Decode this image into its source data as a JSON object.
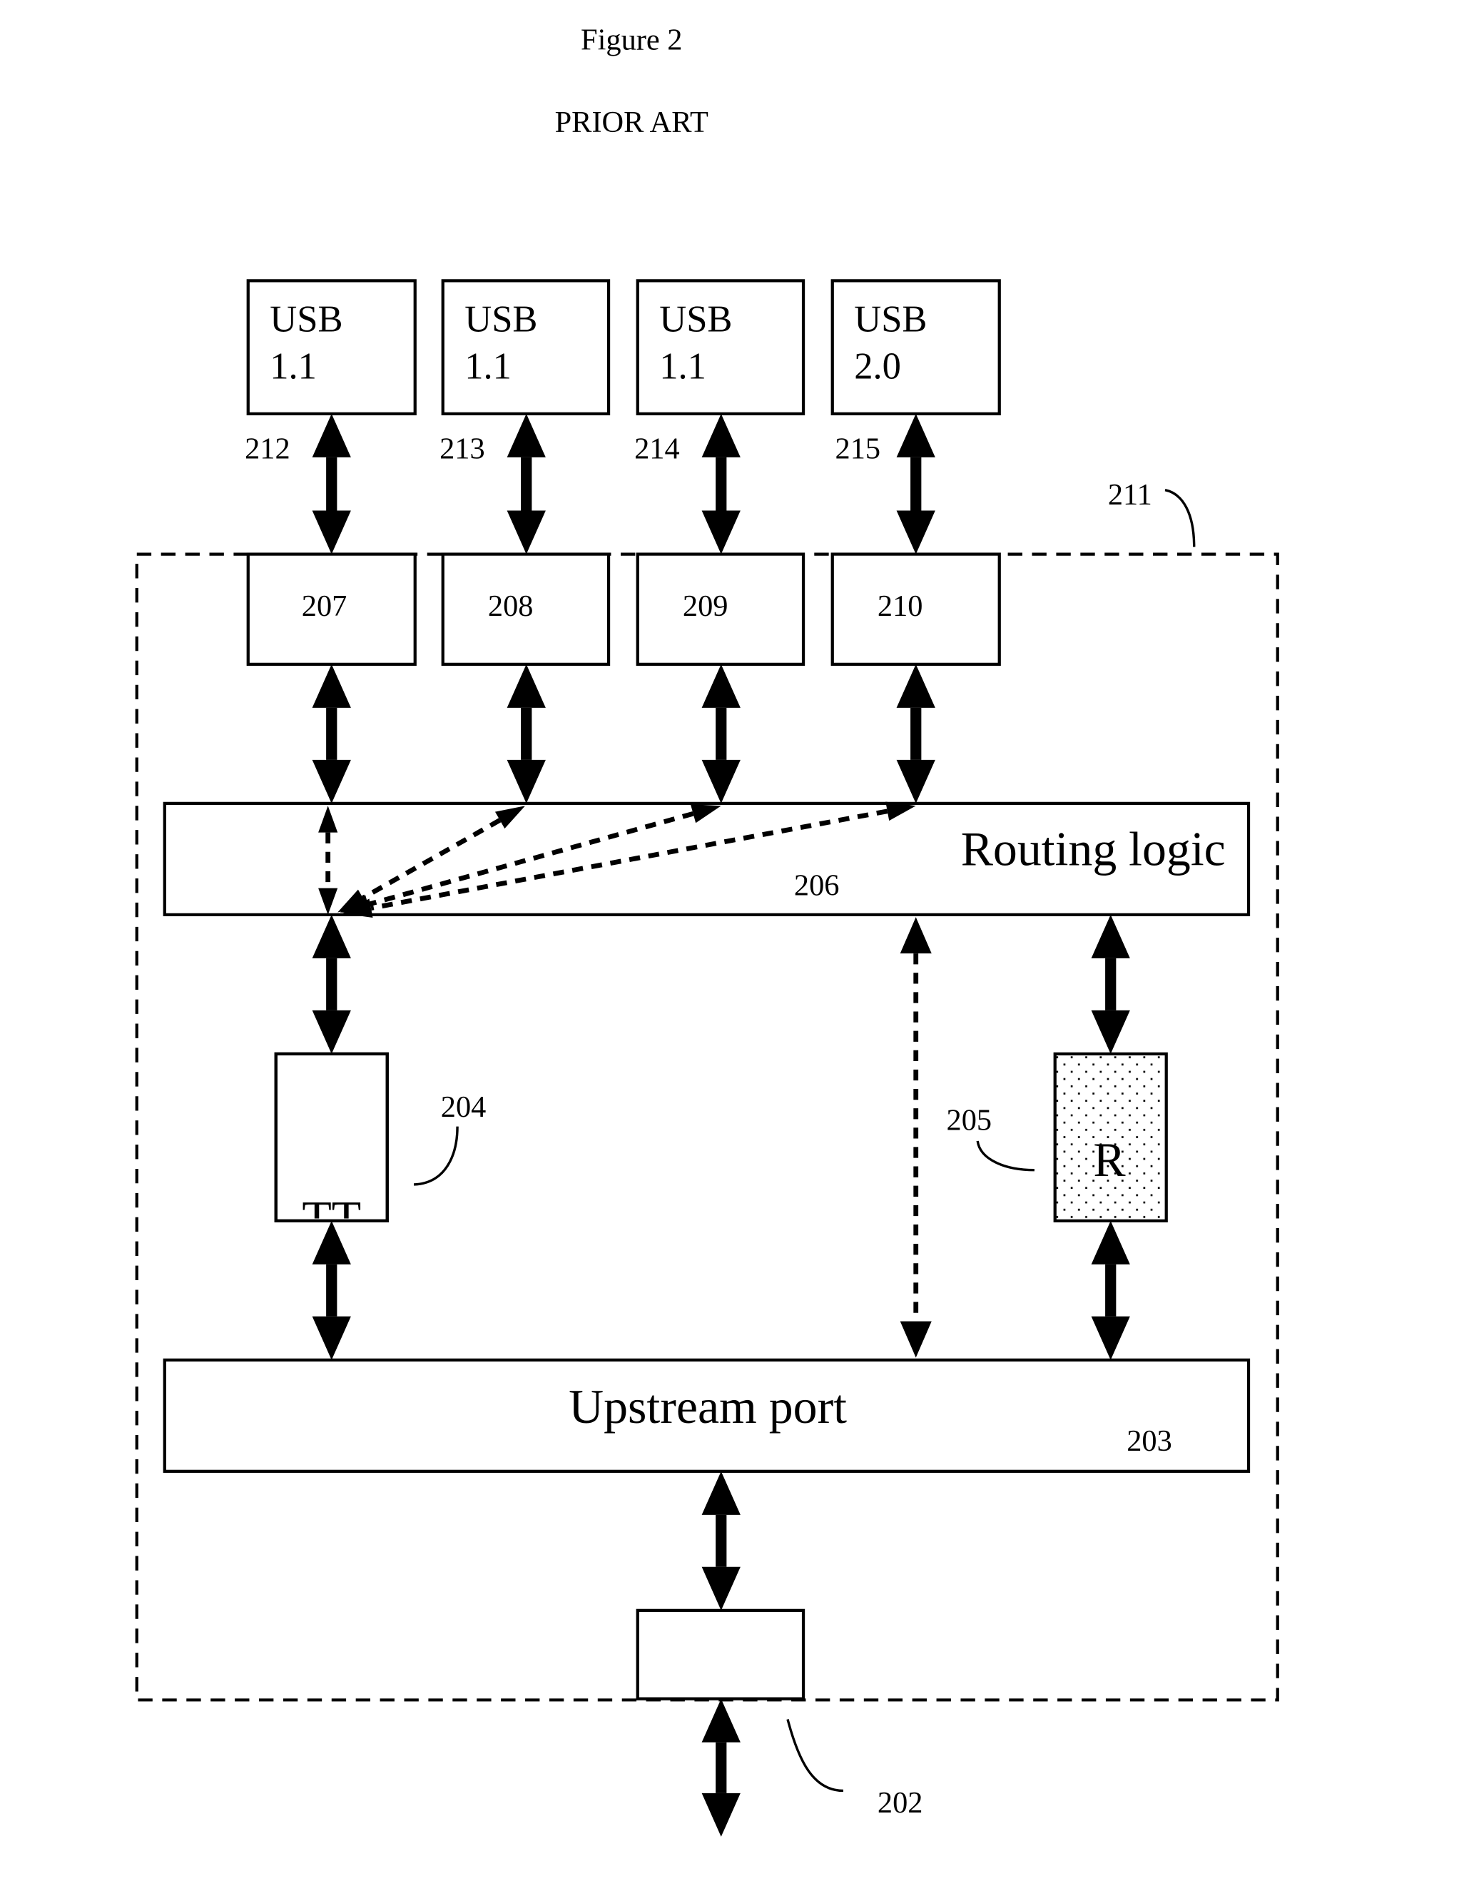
{
  "figure": {
    "title": "Figure 2",
    "subtitle": "PRIOR ART"
  },
  "devices": [
    {
      "line1": "USB",
      "line2": "1.1",
      "link_label": "212"
    },
    {
      "line1": "USB",
      "line2": "1.1",
      "link_label": "213"
    },
    {
      "line1": "USB",
      "line2": "1.1",
      "link_label": "214"
    },
    {
      "line1": "USB",
      "line2": "2.0",
      "link_label": "215"
    }
  ],
  "hub": {
    "label": "211",
    "ports": [
      "207",
      "208",
      "209",
      "210"
    ],
    "routing_logic": {
      "name": "Routing logic",
      "ref": "206"
    },
    "transaction_translator": {
      "name": "TT",
      "ref": "204"
    },
    "repeater": {
      "name": "R",
      "ref": "205"
    },
    "upstream_port": {
      "name": "Upstream port",
      "ref": "203"
    },
    "upstream_connector": {
      "ref": "202"
    }
  }
}
